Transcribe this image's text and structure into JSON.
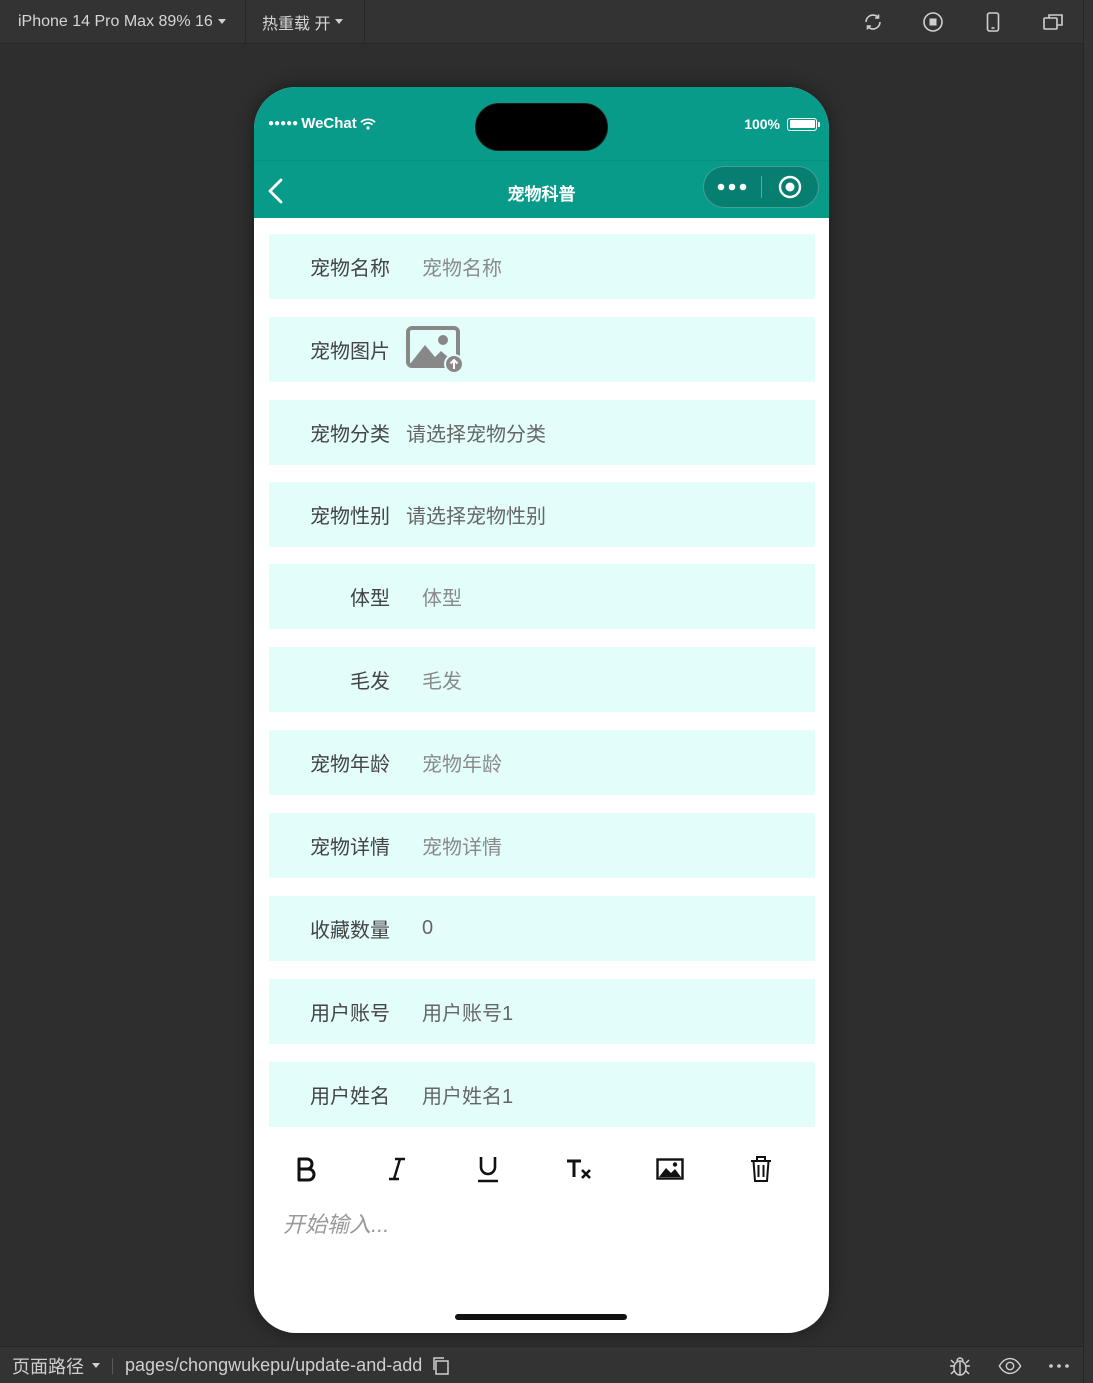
{
  "toolbar": {
    "device": "iPhone 14 Pro Max 89% 16",
    "hot_reload": "热重载 开"
  },
  "status_bar": {
    "carrier": "WeChat",
    "battery": "100%"
  },
  "nav": {
    "title": "宠物科普"
  },
  "form": {
    "fields": [
      {
        "label": "宠物名称",
        "value": "宠物名称"
      },
      {
        "label": "宠物图片",
        "value": ""
      },
      {
        "label": "宠物分类",
        "value": "请选择宠物分类"
      },
      {
        "label": "宠物性别",
        "value": "请选择宠物性别"
      },
      {
        "label": "体型",
        "value": "体型"
      },
      {
        "label": "毛发",
        "value": "毛发"
      },
      {
        "label": "宠物年龄",
        "value": "宠物年龄"
      },
      {
        "label": "宠物详情",
        "value": "宠物详情"
      },
      {
        "label": "收藏数量",
        "value": "0"
      },
      {
        "label": "用户账号",
        "value": "用户账号1"
      },
      {
        "label": "用户姓名",
        "value": "用户姓名1"
      }
    ]
  },
  "editor": {
    "placeholder": "开始输入..."
  },
  "bottom": {
    "path_label": "页面路径",
    "path": "pages/chongwukepu/update-and-add"
  },
  "colors": {
    "header": "#089b8a",
    "row_bg": "#e3fdfb"
  }
}
